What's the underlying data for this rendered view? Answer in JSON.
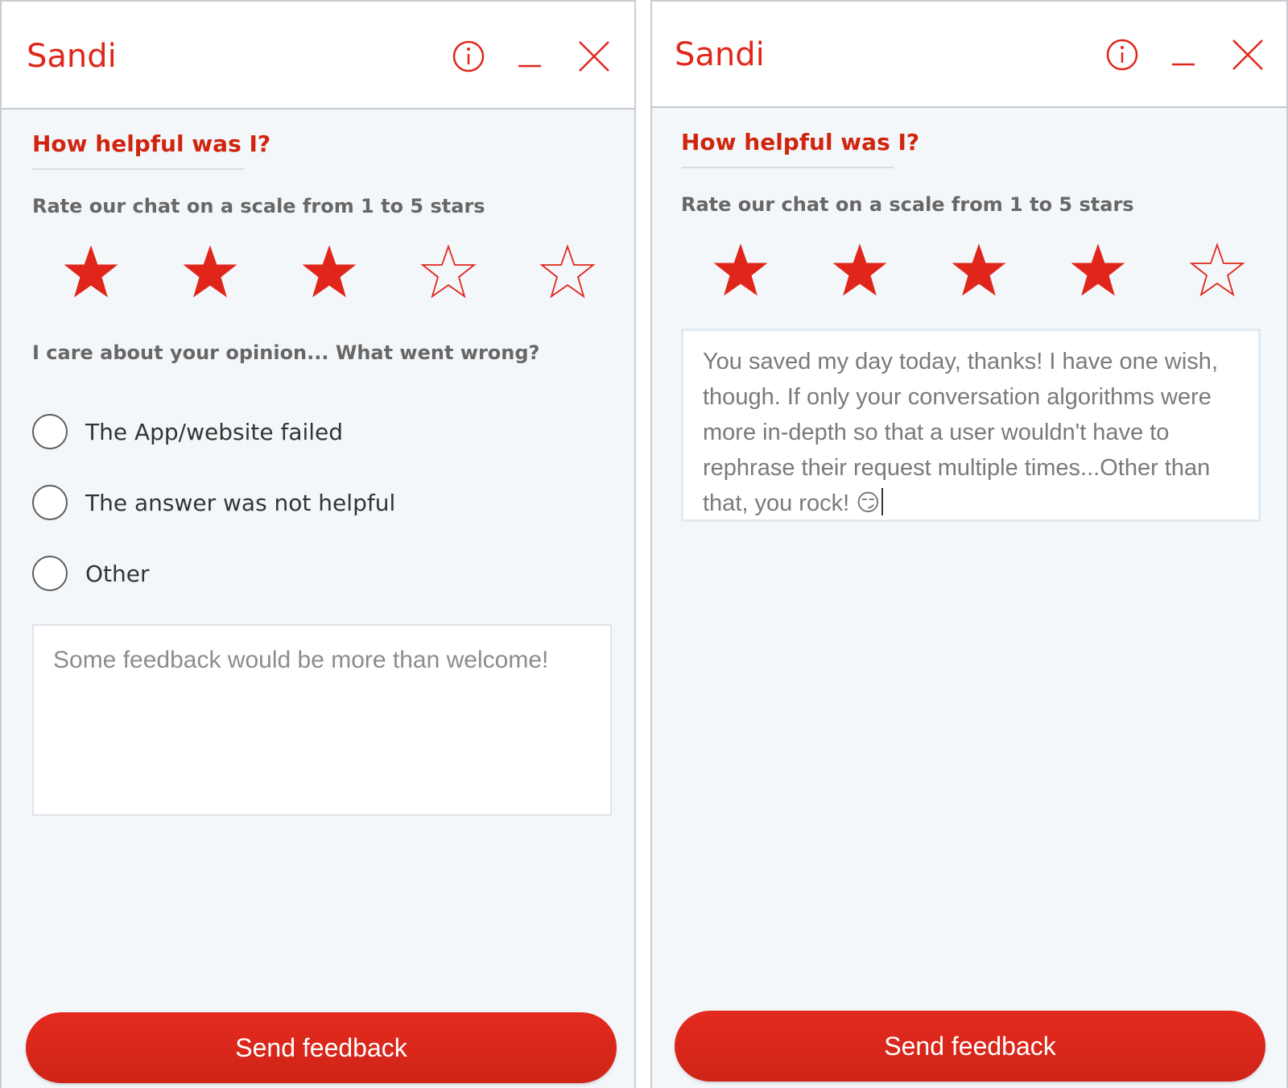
{
  "colors": {
    "accent": "#e0261b",
    "panel_bg": "#f4f7fa",
    "text_gray": "#676767"
  },
  "panels": [
    {
      "header": {
        "title": "Sandi",
        "info_icon": "info-icon",
        "minimize_icon": "minimize-icon",
        "close_icon": "close-icon"
      },
      "title": "How helpful was I?",
      "subtitle": "Rate our chat on a scale from 1 to 5 stars",
      "rating": {
        "value": 3,
        "max": 5
      },
      "question": "I care about your opinion... What went wrong?",
      "options": [
        {
          "label": "The App/website failed",
          "selected": false
        },
        {
          "label": "The answer was not helpful",
          "selected": false
        },
        {
          "label": "Other",
          "selected": false
        }
      ],
      "feedback": {
        "value": "",
        "placeholder": "Some feedback would be more than welcome!"
      },
      "send_label": "Send feedback"
    },
    {
      "header": {
        "title": "Sandi",
        "info_icon": "info-icon",
        "minimize_icon": "minimize-icon",
        "close_icon": "close-icon"
      },
      "title": "How helpful was I?",
      "subtitle": "Rate our chat on a scale from 1 to 5 stars",
      "rating": {
        "value": 4,
        "max": 5
      },
      "feedback": {
        "value": "You saved my day today, thanks! I have one wish, though. If only your conversation algorithms were more in-depth so that a user wouldn't have to rephrase their request multiple times...Other than that, you rock! 😏"
      },
      "send_label": "Send feedback"
    }
  ]
}
